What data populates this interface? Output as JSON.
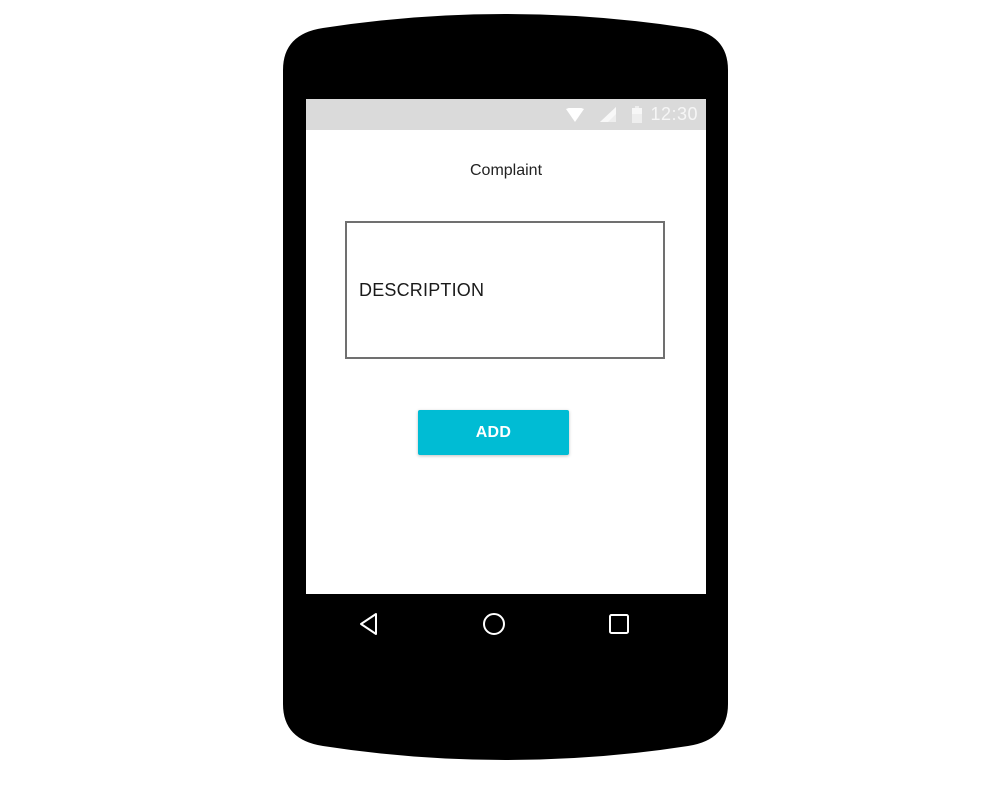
{
  "status_bar": {
    "time": "12:30",
    "icons": [
      "wifi-icon",
      "signal-icon",
      "battery-icon"
    ]
  },
  "screen": {
    "title": "Complaint",
    "description_field": {
      "placeholder": "DESCRIPTION"
    },
    "add_button": {
      "label": "ADD",
      "color": "#00bcd4"
    }
  },
  "navigation": {
    "items": [
      "back-icon",
      "home-icon",
      "recent-apps-icon"
    ]
  },
  "colors": {
    "device": "#000000",
    "status_bar": "#dadada",
    "accent": "#00bcd4"
  }
}
